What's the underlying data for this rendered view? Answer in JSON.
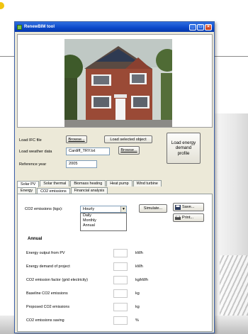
{
  "window": {
    "title": "RenewBIM tool"
  },
  "form": {
    "ifc_label": "Load IFC file",
    "weather_label": "Load weather data",
    "ref_year_label": "Reference year",
    "browse1": "Browse...",
    "browse2": "Browse...",
    "load_selected": "Load selected object",
    "load_energy_demand": "Load energy demand profile",
    "weather_value": "Cardiff_TRY.txt",
    "ref_year_value": "2005"
  },
  "tabs_main": [
    "Solar PV",
    "Solar thermal",
    "Biomass heating",
    "Heat pump",
    "Wind turbine"
  ],
  "tabs_sub": [
    "Energy",
    "CO2 emissions",
    "Financial analysis"
  ],
  "panel": {
    "co2_label": "CO2 emissions (kgs):",
    "select_value": "Hourly",
    "options": [
      "Daily",
      "Monthly",
      "Annual"
    ],
    "simulate": "Simulate...",
    "save": "Save...",
    "print": "Print...",
    "annual": "Annual",
    "rows": [
      {
        "label": "Energy output from PV",
        "unit": "kWh"
      },
      {
        "label": "Energy demand of project",
        "unit": "kWh"
      },
      {
        "label": "CO2 emission factor (grid electricity)",
        "unit": "kg/kWh"
      },
      {
        "label": "Baseline CO2 emissions",
        "unit": "kg"
      },
      {
        "label": "Proposed CO2 emissions",
        "unit": "kg"
      },
      {
        "label": "CO2 emissions saving",
        "unit": "%"
      }
    ]
  },
  "colors": {
    "titlebar": "#0a47c9",
    "window_bg": "#ece9d8",
    "close": "#c63a14"
  },
  "icons": [
    "app-icon",
    "minimize-icon",
    "maximize-icon",
    "close-icon",
    "chevron-down-icon",
    "save-icon",
    "print-icon",
    "house-photo"
  ]
}
